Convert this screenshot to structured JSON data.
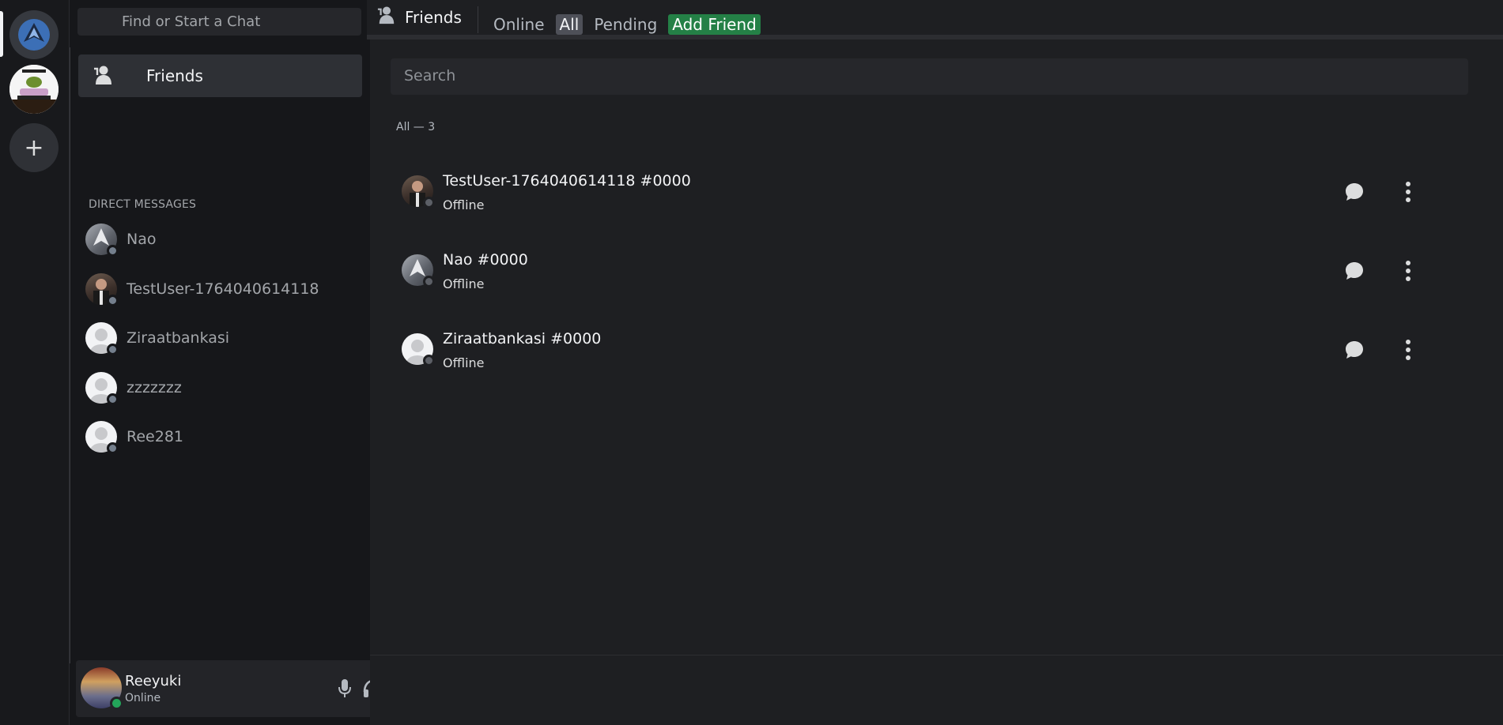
{
  "sidebar": {
    "search_placeholder": "Find or Start a Chat",
    "friends_label": "Friends",
    "dm_header": "DIRECT MESSAGES",
    "dms": [
      {
        "name": "Nao",
        "avatar": "nao"
      },
      {
        "name": "TestUser-1764040614118",
        "avatar": "photo"
      },
      {
        "name": "Ziraatbankasi",
        "avatar": "default"
      },
      {
        "name": "zzzzzzz",
        "avatar": "default"
      },
      {
        "name": "Ree281",
        "avatar": "default"
      }
    ]
  },
  "user": {
    "name": "Reeyuki",
    "status": "Online"
  },
  "header": {
    "title": "Friends",
    "tabs": {
      "online": "Online",
      "all": "All",
      "pending": "Pending",
      "add_friend": "Add Friend"
    }
  },
  "main": {
    "search_placeholder": "Search",
    "count_label": "All — 3",
    "friends": [
      {
        "name": "TestUser-1764040614118 #0000",
        "status": "Offline",
        "avatar": "photo"
      },
      {
        "name": "Nao #0000",
        "status": "Offline",
        "avatar": "nao"
      },
      {
        "name": "Ziraatbankasi #0000",
        "status": "Offline",
        "avatar": "default"
      }
    ]
  },
  "colors": {
    "accent_green": "#248046",
    "online_dot": "#23a55a",
    "offline_dot": "#747f8d"
  }
}
